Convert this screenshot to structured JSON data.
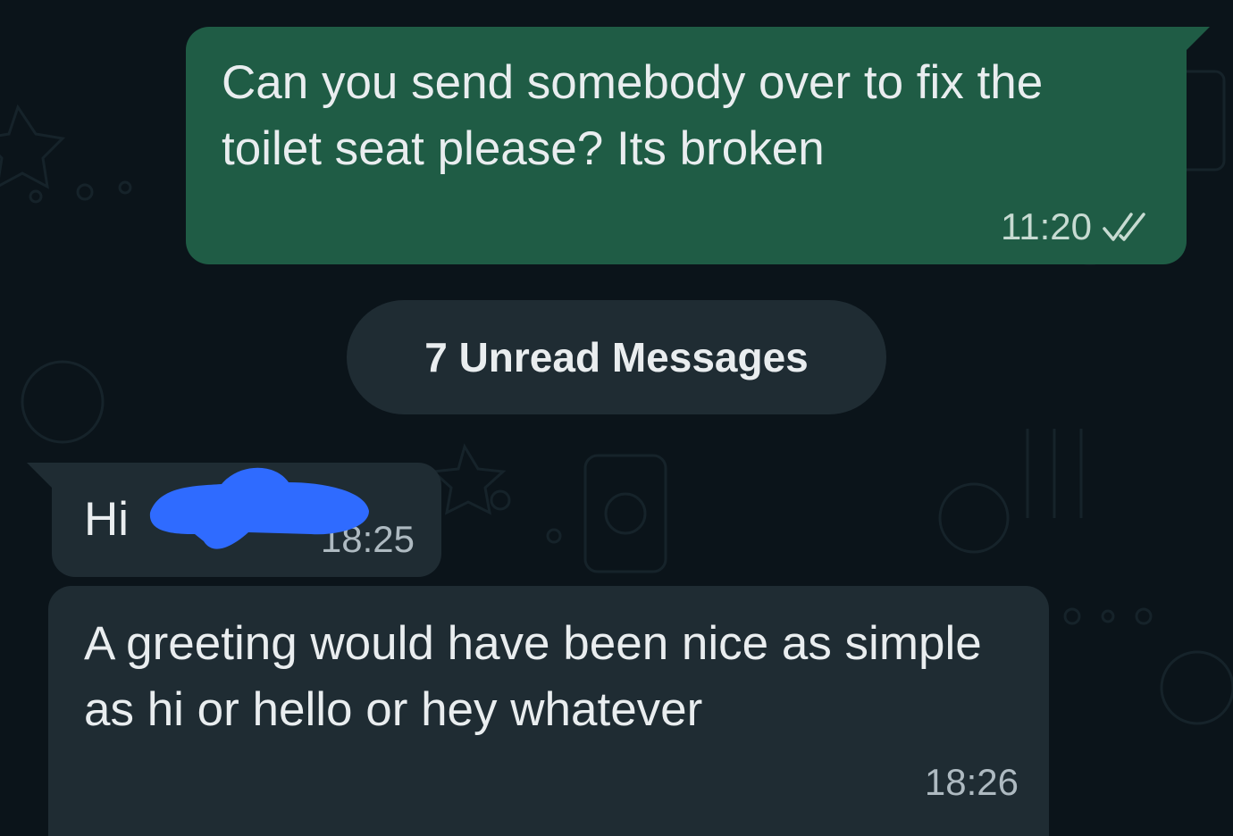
{
  "colors": {
    "background": "#0b141a",
    "outgoing_bubble": "#1f5c45",
    "incoming_bubble": "#1f2c33",
    "read_ticks": "#c7dbd2",
    "redaction": "#2f6bff"
  },
  "messages": [
    {
      "direction": "outgoing",
      "text": "Can you send somebody over to fix the toilet seat please? Its broken",
      "time": "11:20",
      "status_icon": "double-check-icon"
    },
    {
      "direction": "incoming",
      "text": "Hi",
      "time": "18:25",
      "redacted": true
    },
    {
      "direction": "incoming",
      "text": "A greeting would have been nice as simple as hi or hello or hey whatever",
      "time": "18:26"
    }
  ],
  "unread_banner": {
    "label": "7 Unread Messages"
  }
}
